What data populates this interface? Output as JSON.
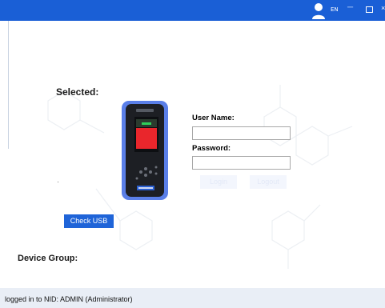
{
  "titlebar": {
    "language": "EN",
    "minimize_glyph": "─",
    "close_glyph": "×",
    "user_icon": "user-icon",
    "color": "#1a5fd6"
  },
  "main": {
    "selected_label": "Selected:",
    "device_image": "handheld-analyzer-device",
    "username_label": "User Name:",
    "username_value": "",
    "password_label": "Password:",
    "password_value": "",
    "login_label": "Login",
    "logout_label": "Logout",
    "check_usb_label": "Check USB",
    "device_group_label": "Device Group:",
    "accent_color": "#1f64d8"
  },
  "status": {
    "text": "logged in to NID: ADMIN (Administrator)"
  }
}
